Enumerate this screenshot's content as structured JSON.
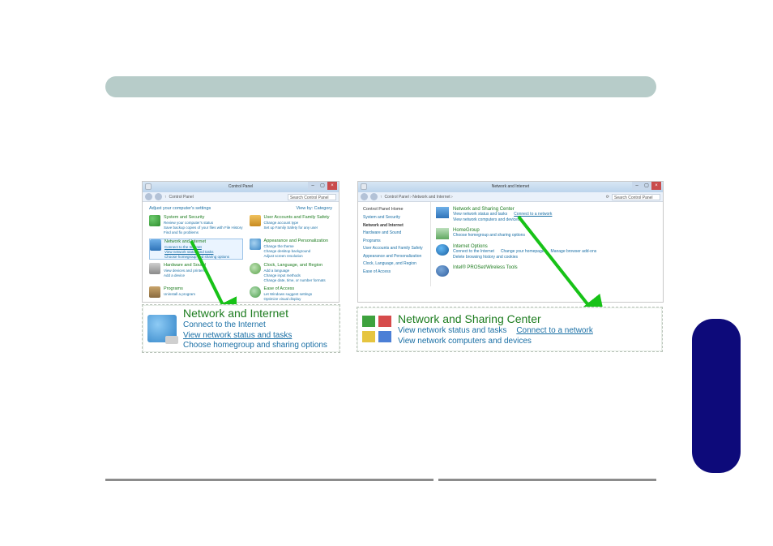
{
  "left_window": {
    "title": "Control Panel",
    "path": "Control Panel",
    "search_placeholder": "Search Control Panel",
    "header_left": "Adjust your computer's settings",
    "header_right": "View by:  Category",
    "categories": {
      "system": {
        "title": "System and Security",
        "s1": "Review your computer's status",
        "s2": "Save backup copies of your files with File History",
        "s3": "Find and fix problems"
      },
      "users": {
        "title": "User Accounts and Family Safety",
        "s1": "Change account type",
        "s2": "Set up Family Safety for any user"
      },
      "network": {
        "title": "Network and Internet",
        "s1": "Connect to the Internet",
        "s2": "View network status and tasks",
        "s3": "Choose homegroup and sharing options"
      },
      "appearance": {
        "title": "Appearance and Personalization",
        "s1": "Change the theme",
        "s2": "Change desktop background",
        "s3": "Adjust screen resolution"
      },
      "hardware": {
        "title": "Hardware and Sound",
        "s1": "View devices and printers",
        "s2": "Add a device"
      },
      "clock": {
        "title": "Clock, Language, and Region",
        "s1": "Add a language",
        "s2": "Change input methods",
        "s3": "Change date, time, or number formats"
      },
      "programs": {
        "title": "Programs",
        "s1": "Uninstall a program"
      },
      "ease": {
        "title": "Ease of Access",
        "s1": "Let Windows suggest settings",
        "s2": "Optimize visual display"
      }
    }
  },
  "right_window": {
    "title": "Network and Internet",
    "path": "Control Panel  ›  Network and Internet  ›",
    "search_placeholder": "Search Control Panel",
    "sidebar": {
      "home": "Control Panel Home",
      "items": [
        "System and Security",
        "Network and Internet",
        "Hardware and Sound",
        "Programs",
        "User Accounts and Family Safety",
        "Appearance and Personalization",
        "Clock, Language, and Region",
        "Ease of Access"
      ]
    },
    "sections": {
      "nsc": {
        "title": "Network and Sharing Center",
        "s1": "View network status and tasks",
        "s2": "Connect to a network",
        "s3": "View network computers and devices"
      },
      "homegroup": {
        "title": "HomeGroup",
        "s1": "Choose homegroup and sharing options"
      },
      "iopts": {
        "title": "Internet Options",
        "s1": "Connect to the Internet",
        "s2": "Change your homepage",
        "s3": "Manage browser add-ons",
        "s4": "Delete browsing history and cookies"
      },
      "intel": {
        "title": "Intel® PROSet/Wireless Tools"
      }
    }
  },
  "callout_left": {
    "title": "Network and Internet",
    "l1": "Connect to the Internet",
    "l2": "View network status and tasks",
    "l3": "Choose homegroup and sharing options"
  },
  "callout_right": {
    "title": "Network and Sharing Center",
    "l1a": "View network status and tasks",
    "l1b": "Connect to a network",
    "l2": "View network computers and devices"
  }
}
